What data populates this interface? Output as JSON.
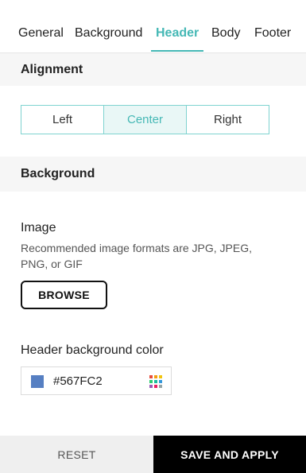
{
  "tabs": [
    {
      "label": "General",
      "active": false
    },
    {
      "label": "Background",
      "active": false
    },
    {
      "label": "Header",
      "active": true
    },
    {
      "label": "Body",
      "active": false
    },
    {
      "label": "Footer",
      "active": false
    }
  ],
  "alignment": {
    "title": "Alignment",
    "options": [
      "Left",
      "Center",
      "Right"
    ],
    "selected": "Center"
  },
  "background": {
    "title": "Background",
    "image": {
      "label": "Image",
      "help": "Recommended image formats are JPG, JPEG, PNG, or GIF",
      "browse_label": "BROWSE"
    },
    "color": {
      "label": "Header background color",
      "value": "#567FC2",
      "swatch": "#567FC2"
    }
  },
  "footer": {
    "reset_label": "RESET",
    "save_label": "SAVE AND APPLY"
  },
  "theme": {
    "accent": "#45b8b5",
    "accent_border": "#7fd3d0"
  },
  "icons": {
    "color_picker": "palette-grid-icon"
  }
}
